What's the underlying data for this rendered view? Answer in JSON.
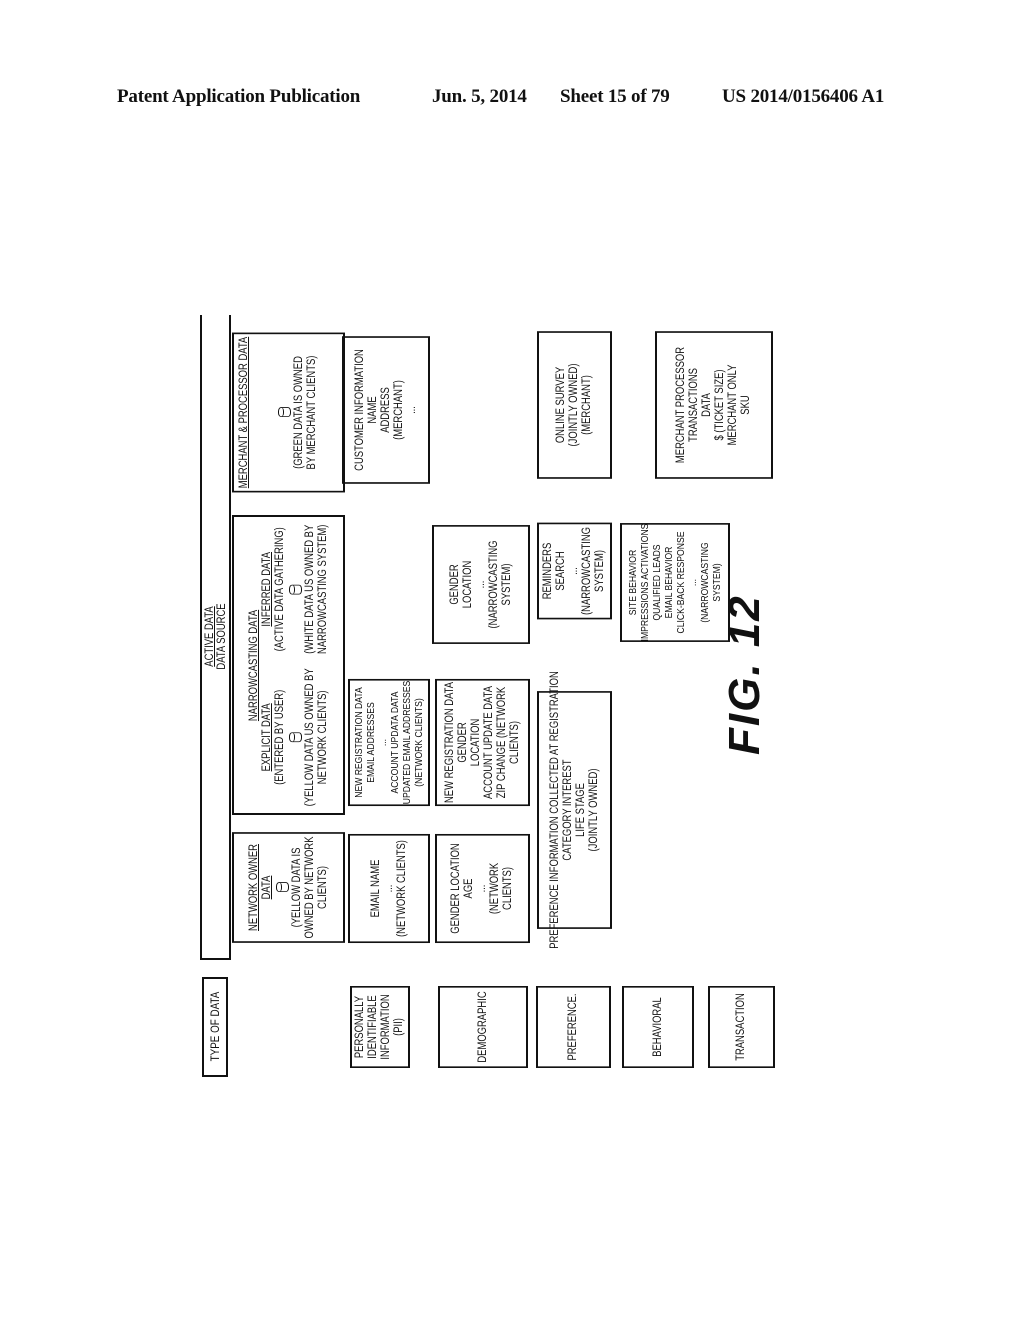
{
  "header": {
    "publication": "Patent Application Publication",
    "date": "Jun. 5, 2014",
    "sheet": "Sheet 15 of 79",
    "number": "US 2014/0156406 A1"
  },
  "diagram": {
    "type_of_data_header": "TYPE OF DATA",
    "active_data_header": "ACTIVE DATA",
    "data_source_header": "DATA SOURCE",
    "row_types": [
      {
        "lines": [
          "PERSONALLY",
          "IDENTIFIABLE",
          "INFORMATION",
          "(PII)"
        ]
      },
      {
        "lines": [
          "DEMOGRAPHIC"
        ]
      },
      {
        "lines": [
          "PREFERENCE."
        ]
      },
      {
        "lines": [
          "BEHAVIORAL"
        ]
      },
      {
        "lines": [
          "TRANSACTION"
        ]
      }
    ],
    "sources": {
      "network_owner": {
        "title_lines": [
          "NETWORK OWNER",
          "DATA"
        ],
        "icon": "database-icon",
        "note_lines": [
          "(YELLOW DATA IS",
          "OWNED BY NETWORK",
          "CLIENTS)"
        ]
      },
      "narrowcasting": {
        "title": "NARROWCASTING DATA",
        "explicit": {
          "title": "EXPLICIT DATA",
          "subtitle": "(ENTERED BY USER)",
          "icon": "database-icon",
          "note_lines": [
            "(YELLOW DATA US OWNED BY",
            "NETWORK CLIENTS)"
          ]
        },
        "inferred": {
          "title": "INFERRED DATA",
          "subtitle": "(ACTIVE DATA GATHERING)",
          "icon": "database-icon",
          "note_lines": [
            "(WHITE DATA US OWNED BY",
            "NARROWCASTING SYSTEM)"
          ]
        }
      },
      "merchant": {
        "title": "MERCHANT & PROCESSOR DATA",
        "icon": "database-icon",
        "note_lines": [
          "(GREEN DATA IS OWNED",
          "BY MERCHANT CLIENTS)"
        ]
      }
    },
    "cells": {
      "pii_network": [
        "EMAIL NAME",
        "...",
        "(NETWORK CLIENTS)"
      ],
      "pii_narrow": [
        "NEW REGISTRATION DATA",
        "EMAIL ADDRESSES",
        "...",
        "ACCOUNT UPDATA DATA",
        "UPDATED EMAIL ADDRESSES",
        "(NETWORK CLIENTS)"
      ],
      "pii_merchant": [
        "CUSTOMER INFORMATION",
        "NAME",
        "ADDRESS",
        "(MERCHANT)",
        "..."
      ],
      "demo_network": [
        "GENDER LOCATION",
        "AGE",
        "...",
        "(NETWORK",
        "CLIENTS)"
      ],
      "demo_explicit": [
        "NEW REGISTRATION DATA",
        "GENDER",
        "LOCATION",
        "ACCOUNT UPDATE DATA",
        "ZIP CHANGE (NETWORK",
        "CLIENTS)"
      ],
      "demo_inferred": [
        "GENDER",
        "LOCATION",
        "...",
        "(NARROWCASTING",
        "SYSTEM)"
      ],
      "pref_joint": [
        "PREFERENCE INFORMATION COLLECTED AT REGISTRATION",
        "CATEGORY INTEREST",
        "LIFE STAGE",
        "(JOINTLY OWNED)"
      ],
      "pref_inferred": [
        "REMINDERS",
        "SEARCH",
        "...",
        "(NARROWCASTING",
        "SYSTEM)"
      ],
      "pref_merchant": [
        "ONLINE SURVEY",
        "(JOINTLY OWNED)",
        "(MERCHANT)"
      ],
      "behav_inferred": [
        "SITE BEHAVIOR",
        "IMPRESSIONS ACTIVATIONS",
        "QUALIFIED LEADS",
        "EMAIL BEHAVIOR",
        "CLICK-BACK RESPONSE",
        "...",
        "(NARROWCASTING",
        "SYSTEM)"
      ],
      "trans_merchant": [
        "MERCHANT PROCESSOR",
        "TRANSACTIONS",
        "DATA",
        "$ (TICKET SIZE)",
        "MERCHANT ONLY",
        "SKU"
      ]
    },
    "figure_label": "FIG. 12"
  }
}
